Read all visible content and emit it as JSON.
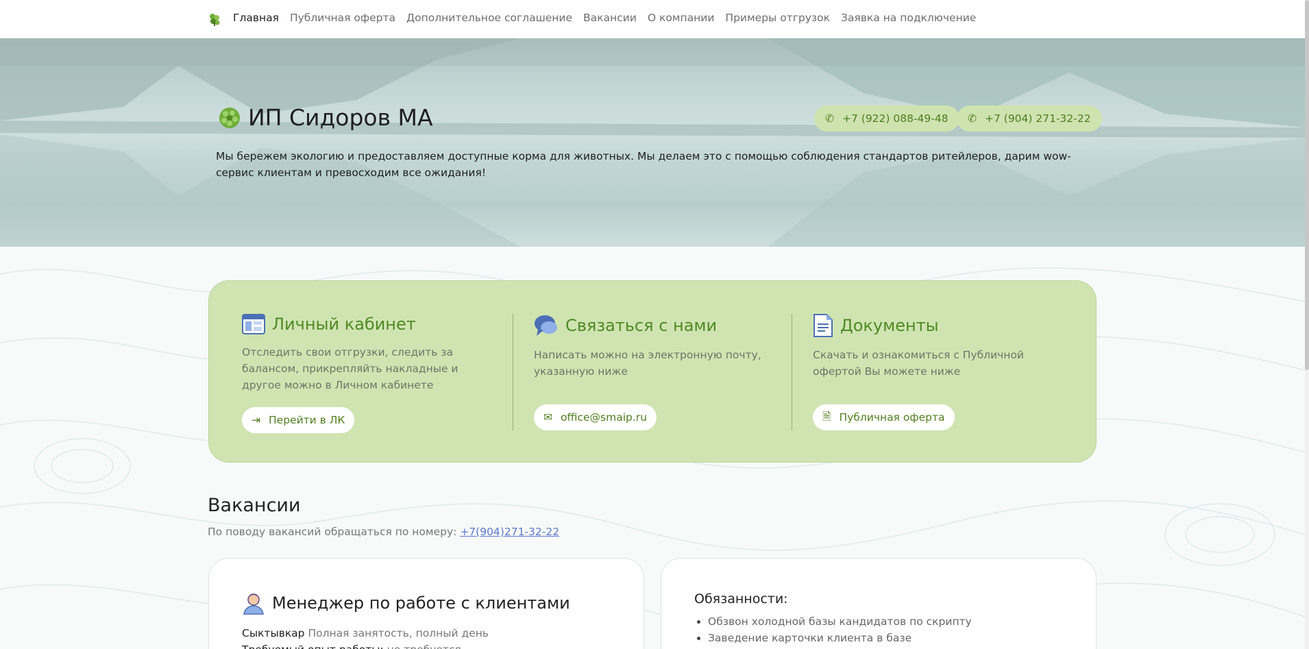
{
  "nav": {
    "logo_icon": "leaf-logo-icon",
    "links": [
      "Главная",
      "Публичная оферта",
      "Дополнительное соглашение",
      "Вакансии",
      "О компании",
      "Примеры отгрузок",
      "Заявка на подключение"
    ]
  },
  "hero": {
    "title": "ИП Сидоров МА",
    "description": "Мы бережем экологию и предоставляем доступные корма для животных. Мы делаем это с помощью соблюдения стандартов ритейлеров, дарим wow-сервис клиентам и превосходим все ожидания!",
    "phones": [
      "+7 (922) 088-49-48",
      "+7 (904) 271-32-22"
    ]
  },
  "cards": {
    "cabinet": {
      "title": "Личный кабинет",
      "text": "Отследить свои отгрузки, следить за балансом, прикрепляйть накладные и другое можно в Личном кабинете",
      "button": "Перейти в ЛК"
    },
    "contact": {
      "title": "Связаться с нами",
      "text": "Написать можно на электронную почту, указанную ниже",
      "button": "office@smaip.ru"
    },
    "docs": {
      "title": "Документы",
      "text": "Скачать и ознакомиться с Публичной офертой Вы можете ниже",
      "button": "Публичная оферта"
    }
  },
  "vacancies": {
    "title": "Вакансии",
    "subtitle": "По поводу вакансий обращаться по номеру: ",
    "phone_link": "+7(904)271-32-22",
    "job": {
      "title": "Менеджер по работе с клиентами",
      "city": "Сыктывкар",
      "employment": " Полная занятость, полный день",
      "experience_label": "Требуемый опыт работы:",
      "experience_value": " не требуется"
    },
    "duties": {
      "title": "Обязанности:",
      "items": [
        "Обзвон холодной базы кандидатов по скрипту",
        "Заведение карточки клиента в базе"
      ]
    }
  },
  "colors": {
    "accent_green": "#4f8a24",
    "card_green": "#d0e4b2",
    "link_blue": "#5b78d0"
  }
}
